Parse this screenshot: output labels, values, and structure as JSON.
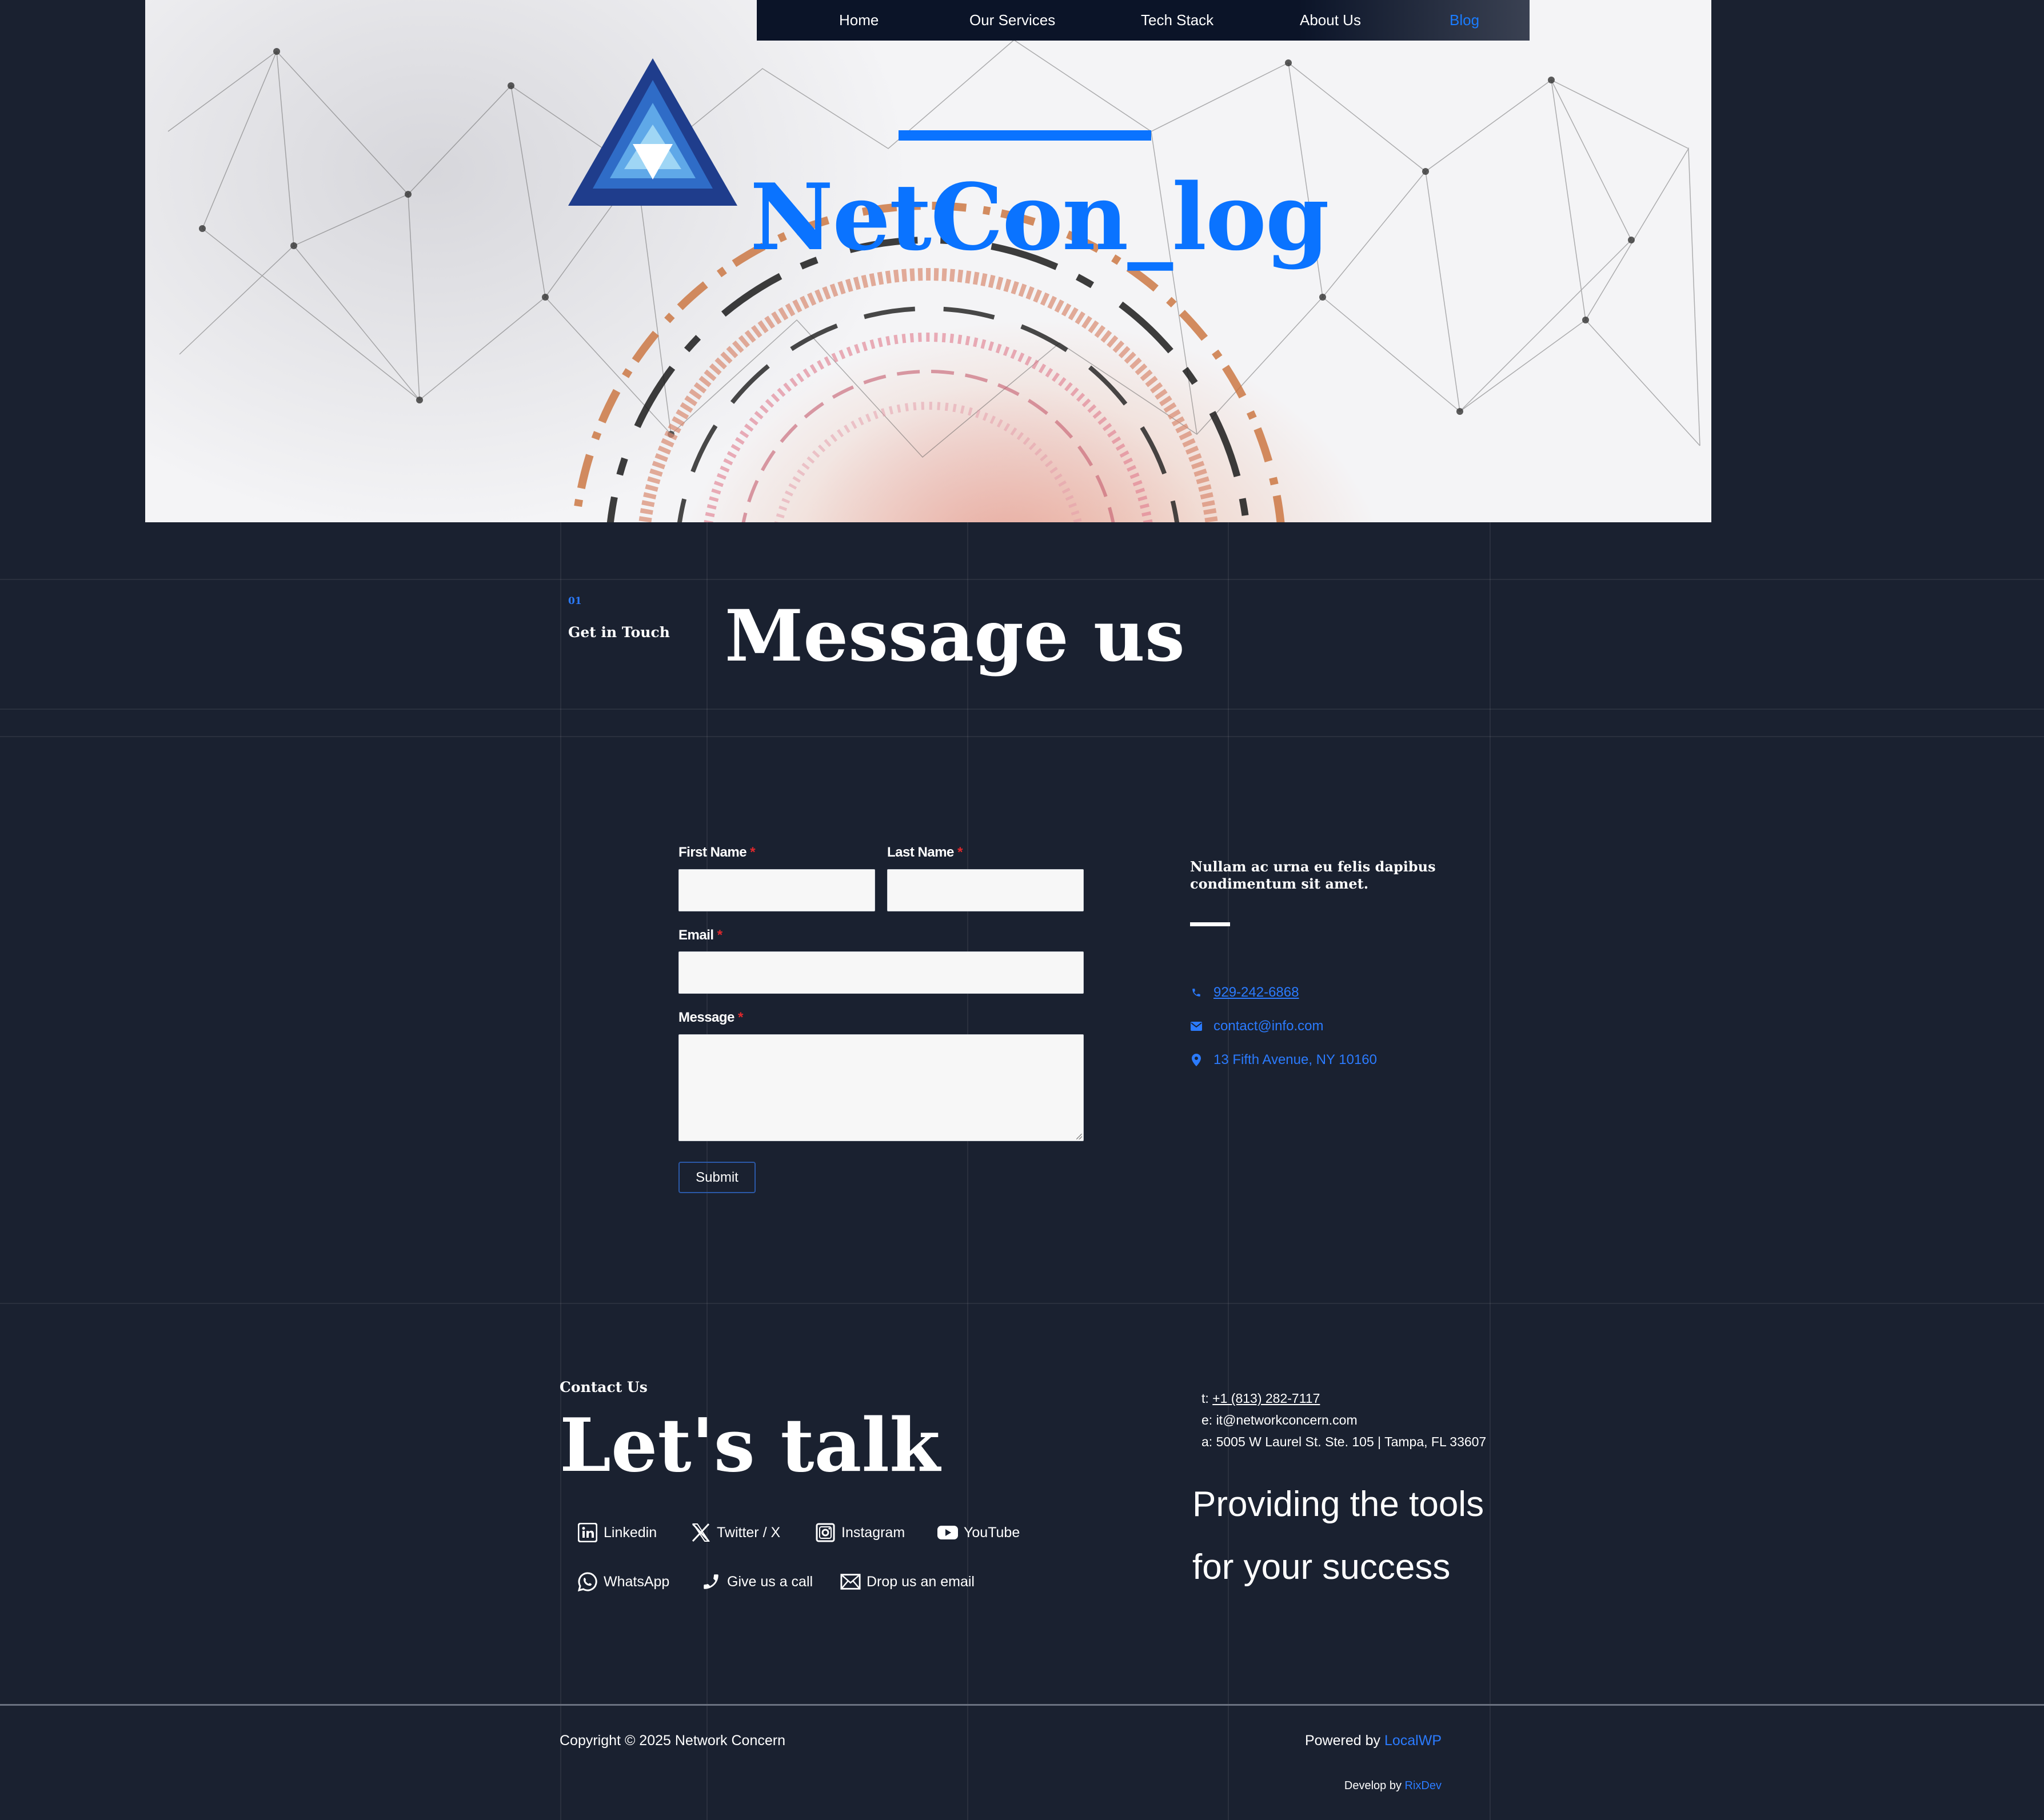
{
  "nav": {
    "items": [
      {
        "label": "Home"
      },
      {
        "label": "Our Services"
      },
      {
        "label": "Tech Stack"
      },
      {
        "label": "About Us"
      },
      {
        "label": "Blog"
      }
    ]
  },
  "hero": {
    "brand": "NetCon_log",
    "logo_icon": "triangle-logo-icon",
    "brand_color": "#0a73ff"
  },
  "message_section": {
    "number": "01",
    "eyebrow": "Get in Touch",
    "title": "Message us"
  },
  "form": {
    "first_name_label": "First Name",
    "last_name_label": "Last Name",
    "email_label": "Email",
    "message_label": "Message",
    "required_mark": "*",
    "submit_label": "Submit"
  },
  "aside": {
    "text": "Nullam ac urna eu felis dapibus condimentum sit amet.",
    "phone": "929-242-6868",
    "email": "contact@info.com",
    "address": "13 Fifth Avenue, NY 10160",
    "icons": [
      "phone-icon",
      "envelope-icon",
      "map-pin-icon"
    ]
  },
  "footer_contact": {
    "eyebrow": "Contact Us",
    "title": "Let's talk",
    "socials": [
      {
        "label": "Linkedin",
        "icon": "linkedin-icon"
      },
      {
        "label": "Twitter / X",
        "icon": "x-twitter-icon"
      },
      {
        "label": "Instagram",
        "icon": "instagram-icon"
      },
      {
        "label": "YouTube",
        "icon": "youtube-icon"
      },
      {
        "label": "WhatsApp",
        "icon": "whatsapp-icon"
      },
      {
        "label": "Give us a call",
        "icon": "phone-icon"
      },
      {
        "label": "Drop us an email",
        "icon": "envelope-icon"
      }
    ],
    "phone_prefix": "t:",
    "phone": "+1 (813) 282-7117",
    "email_line": "e: it@networkconcern.com",
    "address_line": "a: 5005 W Laurel St. Ste. 105 | Tampa, FL 33607",
    "tagline": "Providing the tools for your success"
  },
  "footer": {
    "copyright": "Copyright © 2025 Network Concern",
    "powered_prefix": "Powered by",
    "powered_link": "LocalWP",
    "develop_prefix": "Develop by",
    "develop_link": "RixDev"
  },
  "colors": {
    "background": "#1a2130",
    "accent": "#2b7bff",
    "required": "#e0282c"
  }
}
